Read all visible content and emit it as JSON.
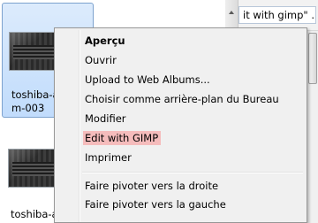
{
  "explorer": {
    "files": [
      {
        "name_line1": "toshiba-a",
        "name_line2": "m-003"
      },
      {
        "name_line1": "toshiba-a"
      }
    ],
    "breadcrumb_fragment": "it with gimp\" ..."
  },
  "context_menu": {
    "items": [
      {
        "label": "Aperçu"
      },
      {
        "label": "Ouvrir"
      },
      {
        "label": "Upload to Web Albums..."
      },
      {
        "label": "Choisir comme arrière-plan du Bureau"
      },
      {
        "label": "Modifier"
      },
      {
        "label": "Edit with GIMP"
      },
      {
        "label": "Imprimer"
      },
      {
        "label": "Faire pivoter vers la droite"
      },
      {
        "label": "Faire pivoter vers la gauche"
      }
    ]
  },
  "colors": {
    "selection": "#c1dcfc",
    "highlight": "#f5bcbc",
    "menu_bg": "#f0f0f0"
  }
}
